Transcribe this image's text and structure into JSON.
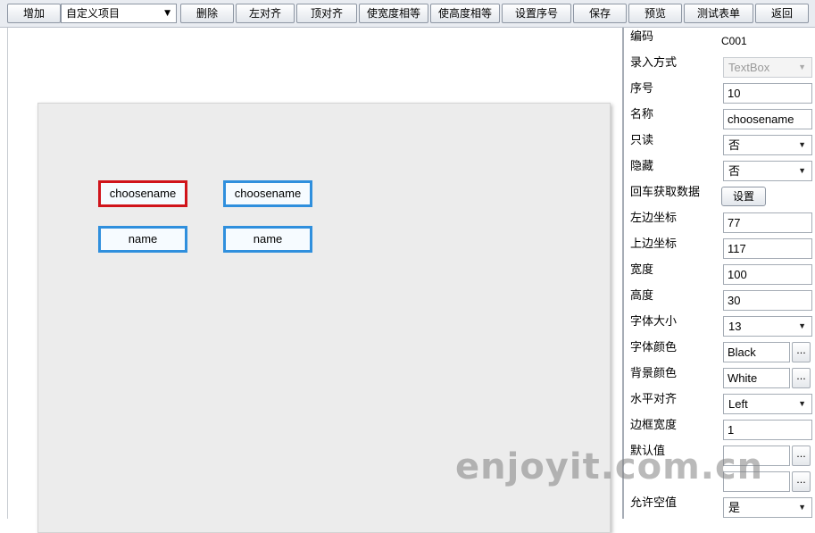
{
  "toolbar": {
    "add": "增加",
    "select_value": "自定义项目",
    "delete": "删除",
    "align_left": "左对齐",
    "align_top": "顶对齐",
    "equal_width": "使宽度相等",
    "equal_height": "使高度相等",
    "set_order": "设置序号",
    "save": "保存",
    "preview": "预览",
    "test_form": "测试表单",
    "back": "返回"
  },
  "canvas": {
    "controls": [
      {
        "text": "choosename"
      },
      {
        "text": "choosename"
      },
      {
        "text": "name"
      },
      {
        "text": "name"
      }
    ]
  },
  "props": {
    "code": {
      "label": "编码",
      "value": "C001"
    },
    "input_mode": {
      "label": "录入方式",
      "value": "TextBox"
    },
    "order": {
      "label": "序号",
      "value": "10"
    },
    "name": {
      "label": "名称",
      "value": "choosename"
    },
    "readonly": {
      "label": "只读",
      "value": "否"
    },
    "hidden": {
      "label": "隐藏",
      "value": "否"
    },
    "enter_fetch": {
      "label": "回车获取数据",
      "button": "设置"
    },
    "left": {
      "label": "左边坐标",
      "value": "77"
    },
    "top": {
      "label": "上边坐标",
      "value": "117"
    },
    "width": {
      "label": "宽度",
      "value": "100"
    },
    "height": {
      "label": "高度",
      "value": "30"
    },
    "font_size": {
      "label": "字体大小",
      "value": "13"
    },
    "font_color": {
      "label": "字体颜色",
      "value": "Black"
    },
    "bg_color": {
      "label": "背景颜色",
      "value": "White"
    },
    "h_align": {
      "label": "水平对齐",
      "value": "Left"
    },
    "border_width": {
      "label": "边框宽度",
      "value": "1"
    },
    "default_value": {
      "label": "默认值",
      "value": ""
    },
    "row17": {
      "label": "",
      "value": ""
    },
    "allow_null": {
      "label": "允许空值",
      "value": "是"
    },
    "ellipsis": "..."
  },
  "watermark": "enjoyit.com.cn",
  "colors": {
    "selected_border": "#d0141b",
    "control_border": "#2f8fdd",
    "canvas_bg": "#ececec"
  }
}
